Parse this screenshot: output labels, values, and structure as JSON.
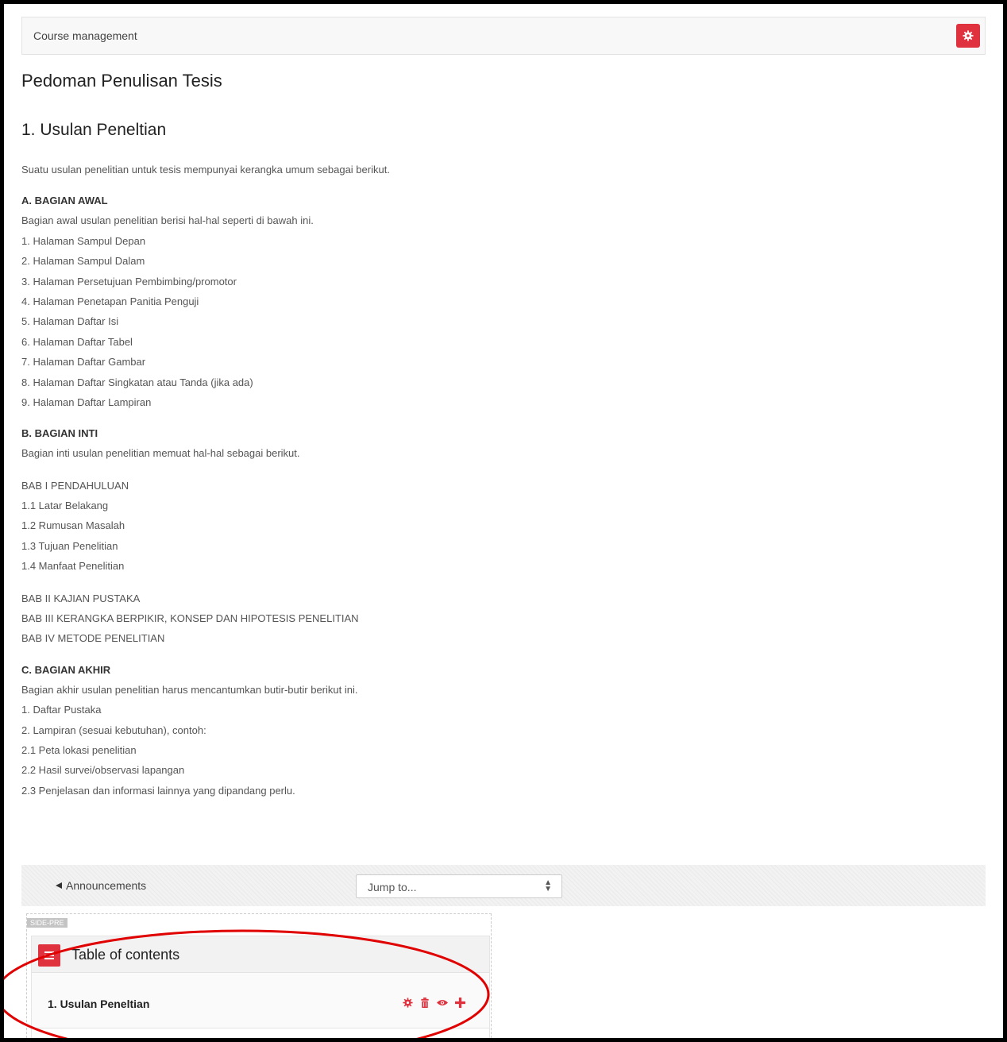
{
  "breadcrumb": "Course management",
  "page_title": "Pedoman Penulisan Tesis",
  "section_title": "1. Usulan Peneltian",
  "content": {
    "intro": "Suatu usulan penelitian untuk tesis mempunyai kerangka umum sebagai berikut.",
    "part_a": {
      "heading": "A. BAGIAN AWAL",
      "lead": "Bagian awal usulan penelitian berisi hal-hal seperti di bawah ini.",
      "items": [
        "1. Halaman Sampul Depan",
        "2. Halaman Sampul Dalam",
        "3. Halaman Persetujuan Pembimbing/promotor",
        "4. Halaman Penetapan Panitia Penguji",
        "5. Halaman Daftar Isi",
        "6. Halaman Daftar Tabel",
        "7. Halaman Daftar Gambar",
        "8. Halaman Daftar Singkatan atau Tanda (jika ada)",
        "9. Halaman Daftar Lampiran"
      ]
    },
    "part_b": {
      "heading": "B. BAGIAN INTI",
      "lead": "Bagian inti usulan penelitian memuat hal-hal sebagai berikut.",
      "bab1": [
        "BAB I PENDAHULUAN",
        "1.1 Latar Belakang",
        "1.2 Rumusan Masalah",
        "1.3 Tujuan Penelitian",
        "1.4 Manfaat Penelitian"
      ],
      "bab_rest": [
        "BAB II KAJIAN PUSTAKA",
        "BAB III KERANGKA BERPIKIR, KONSEP DAN HIPOTESIS PENELITIAN",
        "BAB IV METODE PENELITIAN"
      ]
    },
    "part_c": {
      "heading": "C. BAGIAN AKHIR",
      "lead": "Bagian akhir usulan penelitian harus mencantumkan butir-butir berikut ini.",
      "items": [
        "1. Daftar Pustaka",
        "2. Lampiran (sesuai kebutuhan), contoh:",
        "2.1 Peta lokasi penelitian",
        "2.2 Hasil survei/observasi lapangan",
        "2.3 Penjelasan dan informasi lainnya yang dipandang perlu."
      ]
    }
  },
  "nav": {
    "prev_label": "Announcements",
    "jump_value": "Jump to..."
  },
  "region_tag": "SIDE-PRE",
  "toc_block": {
    "title": "Table of contents",
    "item_label": "1. Usulan Peneltian",
    "actions": [
      "gear-icon",
      "trash-icon",
      "eye-icon",
      "plus-icon"
    ]
  },
  "colors": {
    "accent": "#e0323e",
    "annotation": "#e00000"
  }
}
